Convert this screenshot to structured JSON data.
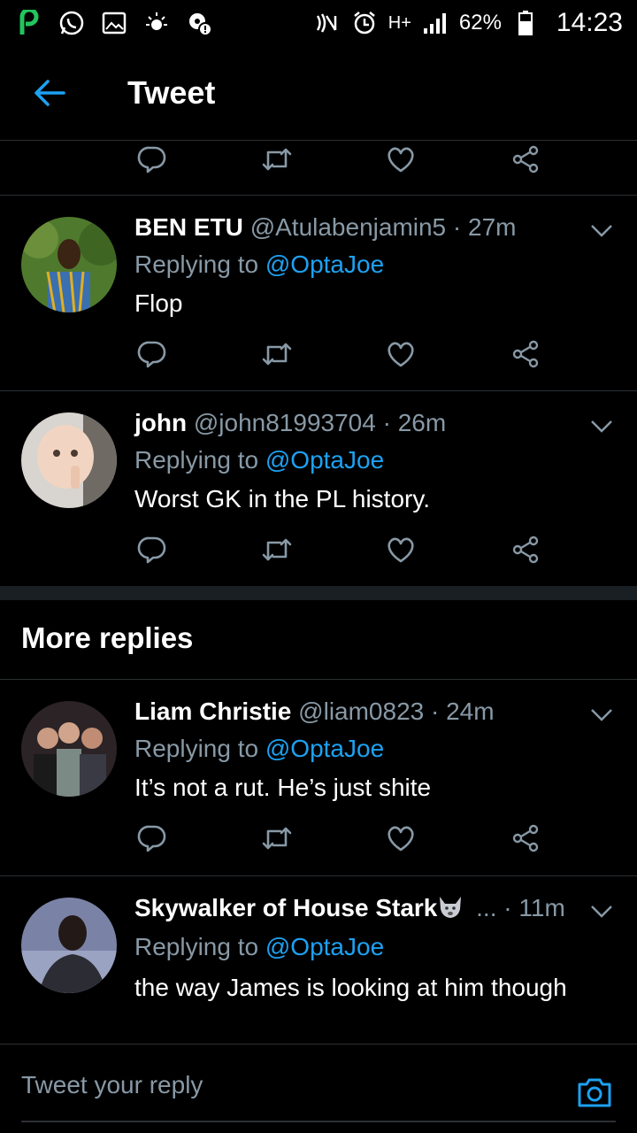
{
  "status_bar": {
    "battery": "62%",
    "time": "14:23",
    "network": "H+",
    "left_icons": [
      "p-app-icon",
      "whatsapp-icon",
      "gallery-icon",
      "brightness-icon",
      "settings-badge-icon"
    ],
    "right_icons": [
      "nfc-icon",
      "mute-icon",
      "alarm-icon",
      "signal-icon",
      "battery-icon"
    ]
  },
  "header": {
    "title": "Tweet",
    "back_icon": "back-arrow-icon"
  },
  "colors": {
    "accent": "#1da1f2",
    "muted": "#8899a6",
    "background": "#000000"
  },
  "replies": [
    {
      "name": "BEN ETU",
      "handle": "@Atulabenjamin5 · 27m",
      "replying_prefix": "Replying to ",
      "replying_to": "@OptaJoe",
      "text": "Flop"
    },
    {
      "name": "john",
      "handle": "@john81993704 · 26m",
      "replying_prefix": "Replying to ",
      "replying_to": "@OptaJoe",
      "text": "Worst GK in the PL history."
    }
  ],
  "more_replies": {
    "title": "More replies",
    "items": [
      {
        "name": "Liam Christie",
        "handle": "@liam0823 · 24m",
        "replying_prefix": "Replying to ",
        "replying_to": "@OptaJoe",
        "text": "It’s not a rut. He’s just shite"
      },
      {
        "name": "Skywalker of House Stark",
        "name_emoji": "wolf-emoji-icon",
        "handle": "... · 11m",
        "replying_prefix": "Replying to ",
        "replying_to": "@OptaJoe",
        "text": "the way James is looking at him though"
      }
    ]
  },
  "compose": {
    "placeholder": "Tweet your reply",
    "camera_icon": "camera-icon"
  }
}
